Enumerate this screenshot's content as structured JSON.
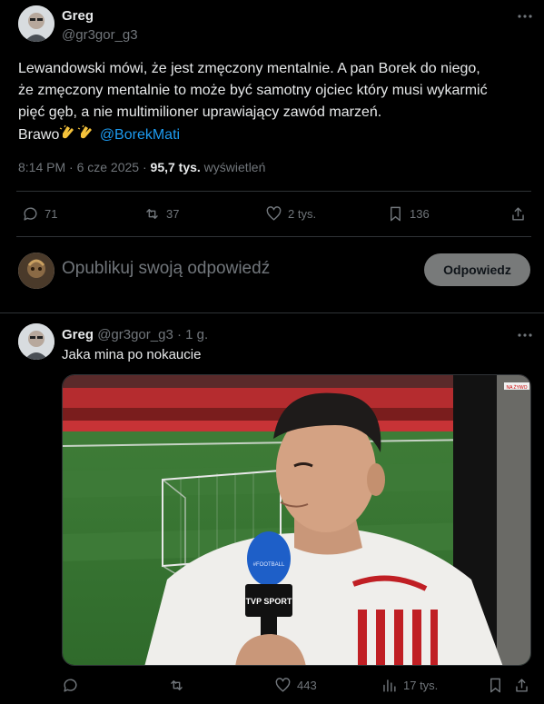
{
  "main_tweet": {
    "author_name": "Greg",
    "author_handle": "@gr3gor_g3",
    "text_line1": "Lewandowski mówi, że jest zmęczony mentalnie. A pan Borek do niego,",
    "text_line2": "że zmęczony mentalnie to może być samotny ojciec który musi wykarmić",
    "text_line3": "pięć gęb, a nie multimilioner uprawiający zawód marzeń.",
    "text_prefix": "Brawo",
    "mention": "@BorekMati",
    "meta_time": "8:14 PM · 6 cze 2025 · ",
    "meta_views_count": "95,7 tys.",
    "meta_views_label": " wyświetleń",
    "actions": {
      "replies": "71",
      "reposts": "37",
      "likes": "2 tys.",
      "bookmarks": "136"
    }
  },
  "reply_composer": {
    "placeholder": "Opublikuj swoją odpowiedź",
    "button_label": "Odpowiedz"
  },
  "reply_tweet": {
    "author_name": "Greg",
    "author_handle": "@gr3gor_g3",
    "separator": "·",
    "time": "1 g.",
    "text": "Jaka mina po nokaucie",
    "media": {
      "mic_label": "TVP SPORT",
      "mic_flag": "#FOOTBALL",
      "corner_badge": "NA ŻYWO"
    },
    "actions": {
      "replies": "",
      "reposts": "",
      "likes": "443",
      "views": "17 tys."
    }
  },
  "colors": {
    "background": "#000000",
    "text": "#e7e9ea",
    "muted": "#71767b",
    "link": "#1d9bf0",
    "divider": "#2f3336",
    "reply_button_bg": "#787a7a"
  }
}
